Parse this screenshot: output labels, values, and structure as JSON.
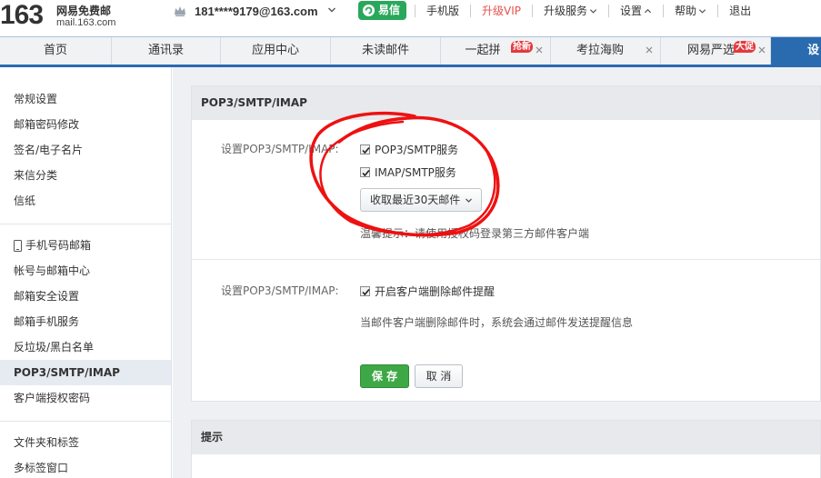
{
  "header": {
    "logo_number": "163",
    "logo_name": "网易免费邮",
    "logo_domain": "mail.163.com",
    "account": "181****9179@163.com",
    "yixin_label": "易信",
    "links": {
      "mobile": "手机版",
      "vip": "升级VIP",
      "upgrade": "升级服务",
      "settings": "设置",
      "help": "帮助",
      "logout": "退出"
    }
  },
  "tabs": {
    "home": "首页",
    "contacts": "通讯录",
    "apps": "应用中心",
    "unread": "未读邮件",
    "pinhui": "一起拼",
    "pinhui_badge": "抢新",
    "kaola": "考拉海购",
    "yanxuan": "网易严选",
    "yanxuan_badge": "大促",
    "settings": "设"
  },
  "sidebar": {
    "items": [
      "常规设置",
      "邮箱密码修改",
      "签名/电子名片",
      "来信分类",
      "信纸",
      "手机号码邮箱",
      "帐号与邮箱中心",
      "邮箱安全设置",
      "邮箱手机服务",
      "反垃圾/黑白名单",
      "POP3/SMTP/IMAP",
      "客户端授权密码",
      "文件夹和标签",
      "多标签窗口"
    ]
  },
  "main": {
    "section_title": "POP3/SMTP/IMAP",
    "row1": {
      "label": "设置POP3/SMTP/IMAP:",
      "pop3_label": "POP3/SMTP服务",
      "imap_label": "IMAP/SMTP服务",
      "receive_select": "收取最近30天邮件",
      "tip": "温馨提示：请使用授权码登录第三方邮件客户端"
    },
    "row2": {
      "label": "设置POP3/SMTP/IMAP:",
      "delete_notice_label": "开启客户端删除邮件提醒",
      "tip": "当邮件客户端删除邮件时，系统会通过邮件发送提醒信息"
    },
    "save_label": "保 存",
    "cancel_label": "取 消",
    "hint_title": "提示"
  },
  "colors": {
    "accent_blue": "#2a6bb0",
    "save_green": "#3ea846",
    "yixin_green": "#29a85b",
    "vip_red": "#e5514c",
    "annotation_red": "#ee1111"
  }
}
